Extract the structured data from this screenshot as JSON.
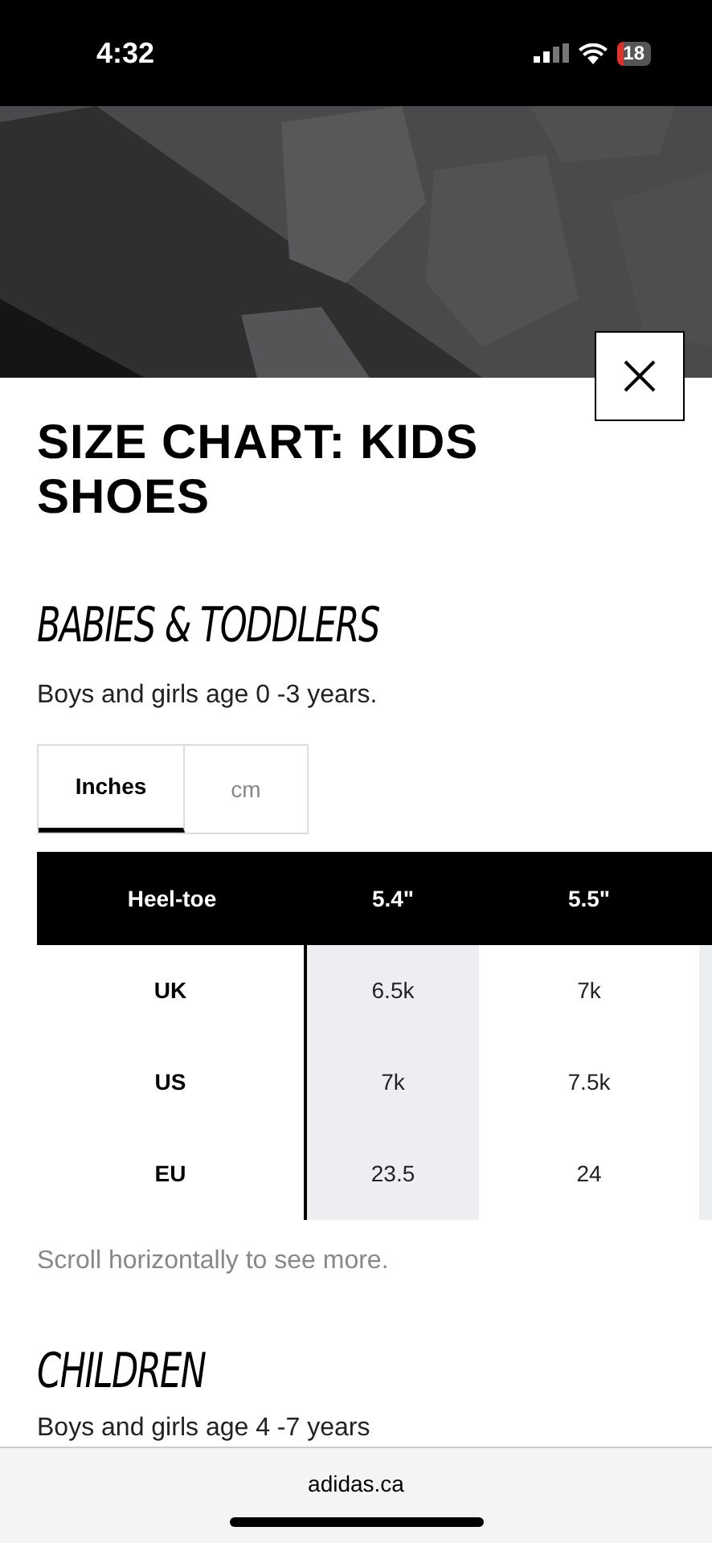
{
  "status_bar": {
    "time": "4:32",
    "battery": "18"
  },
  "title": "SIZE CHART: KIDS SHOES",
  "sections": [
    {
      "heading": "BABIES & TODDLERS",
      "subtitle": "Boys and girls age 0 -3 years.",
      "unit_tabs": [
        {
          "label": "Inches",
          "selected": true
        },
        {
          "label": "cm",
          "selected": false
        }
      ],
      "table": {
        "columns": [
          "Heel-toe",
          "5.4\"",
          "5.5\""
        ],
        "rows": [
          [
            "UK",
            "6.5k",
            "7k"
          ],
          [
            "US",
            "7k",
            "7.5k"
          ],
          [
            "EU",
            "23.5",
            "24"
          ]
        ]
      },
      "note": "Scroll horizontally to see more."
    },
    {
      "heading": "CHILDREN",
      "subtitle": "Boys and girls age 4 -7 years"
    }
  ],
  "browser_bar": {
    "url": "adidas.ca"
  }
}
